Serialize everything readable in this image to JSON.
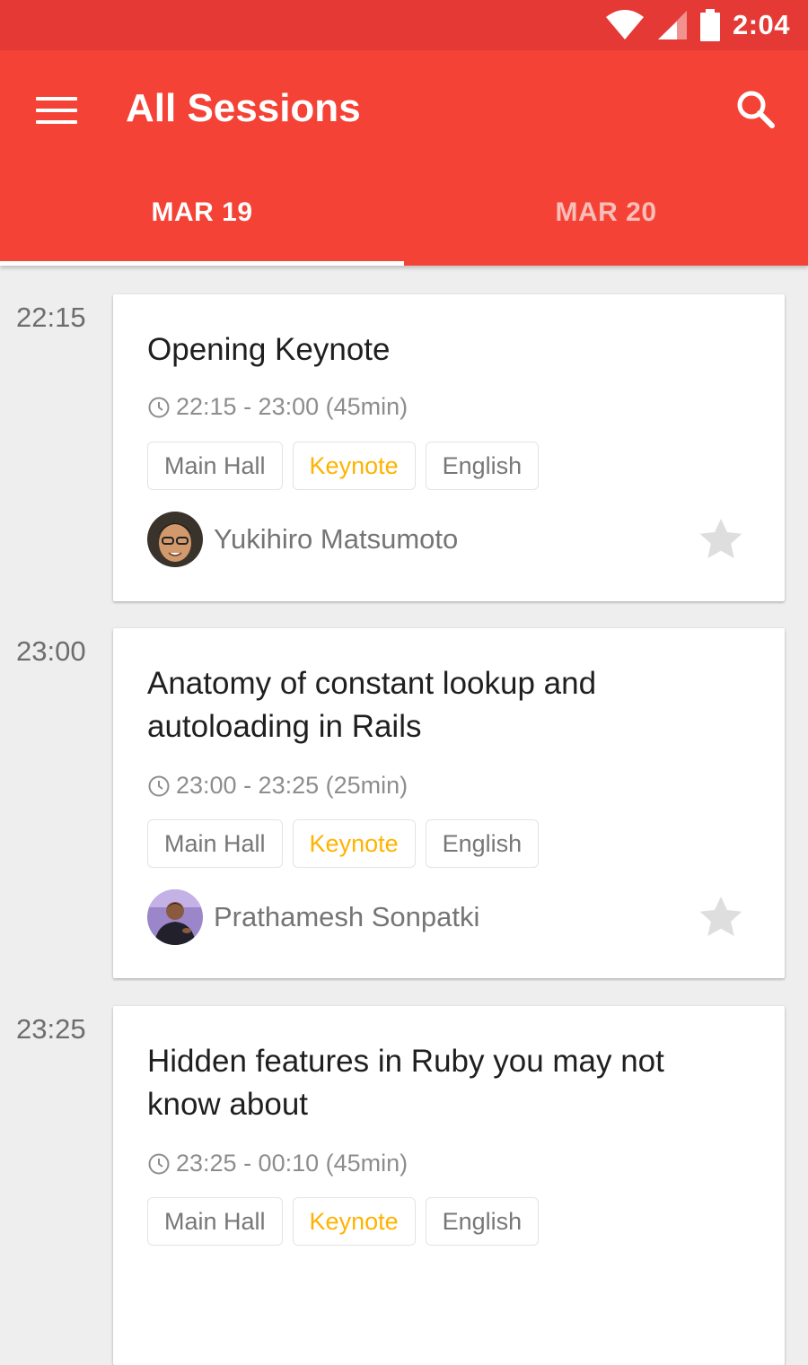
{
  "status_bar": {
    "time": "2:04"
  },
  "app_bar": {
    "title": "All Sessions"
  },
  "tabs": [
    {
      "label": "MAR 19",
      "selected": true
    },
    {
      "label": "MAR 20",
      "selected": false
    }
  ],
  "colors": {
    "primary": "#f44336",
    "primary_dark": "#e53935",
    "keynote_tag": "#ffb300",
    "background": "#eeeeee"
  },
  "sessions": [
    {
      "start_time": "22:15",
      "title": "Opening Keynote",
      "duration": "22:15 - 23:00 (45min)",
      "tags": [
        "Main Hall",
        "Keynote",
        "English"
      ],
      "speaker": "Yukihiro Matsumoto",
      "favorite_icon": "star-icon"
    },
    {
      "start_time": "23:00",
      "title": "Anatomy of constant lookup and autoloading in Rails",
      "duration": "23:00 - 23:25 (25min)",
      "tags": [
        "Main Hall",
        "Keynote",
        "English"
      ],
      "speaker": "Prathamesh Sonpatki",
      "favorite_icon": "star-icon"
    },
    {
      "start_time": "23:25",
      "title": "Hidden features in Ruby you may not know about",
      "duration": "23:25 - 00:10 (45min)",
      "tags": [
        "Main Hall",
        "Keynote",
        "English"
      ]
    }
  ]
}
